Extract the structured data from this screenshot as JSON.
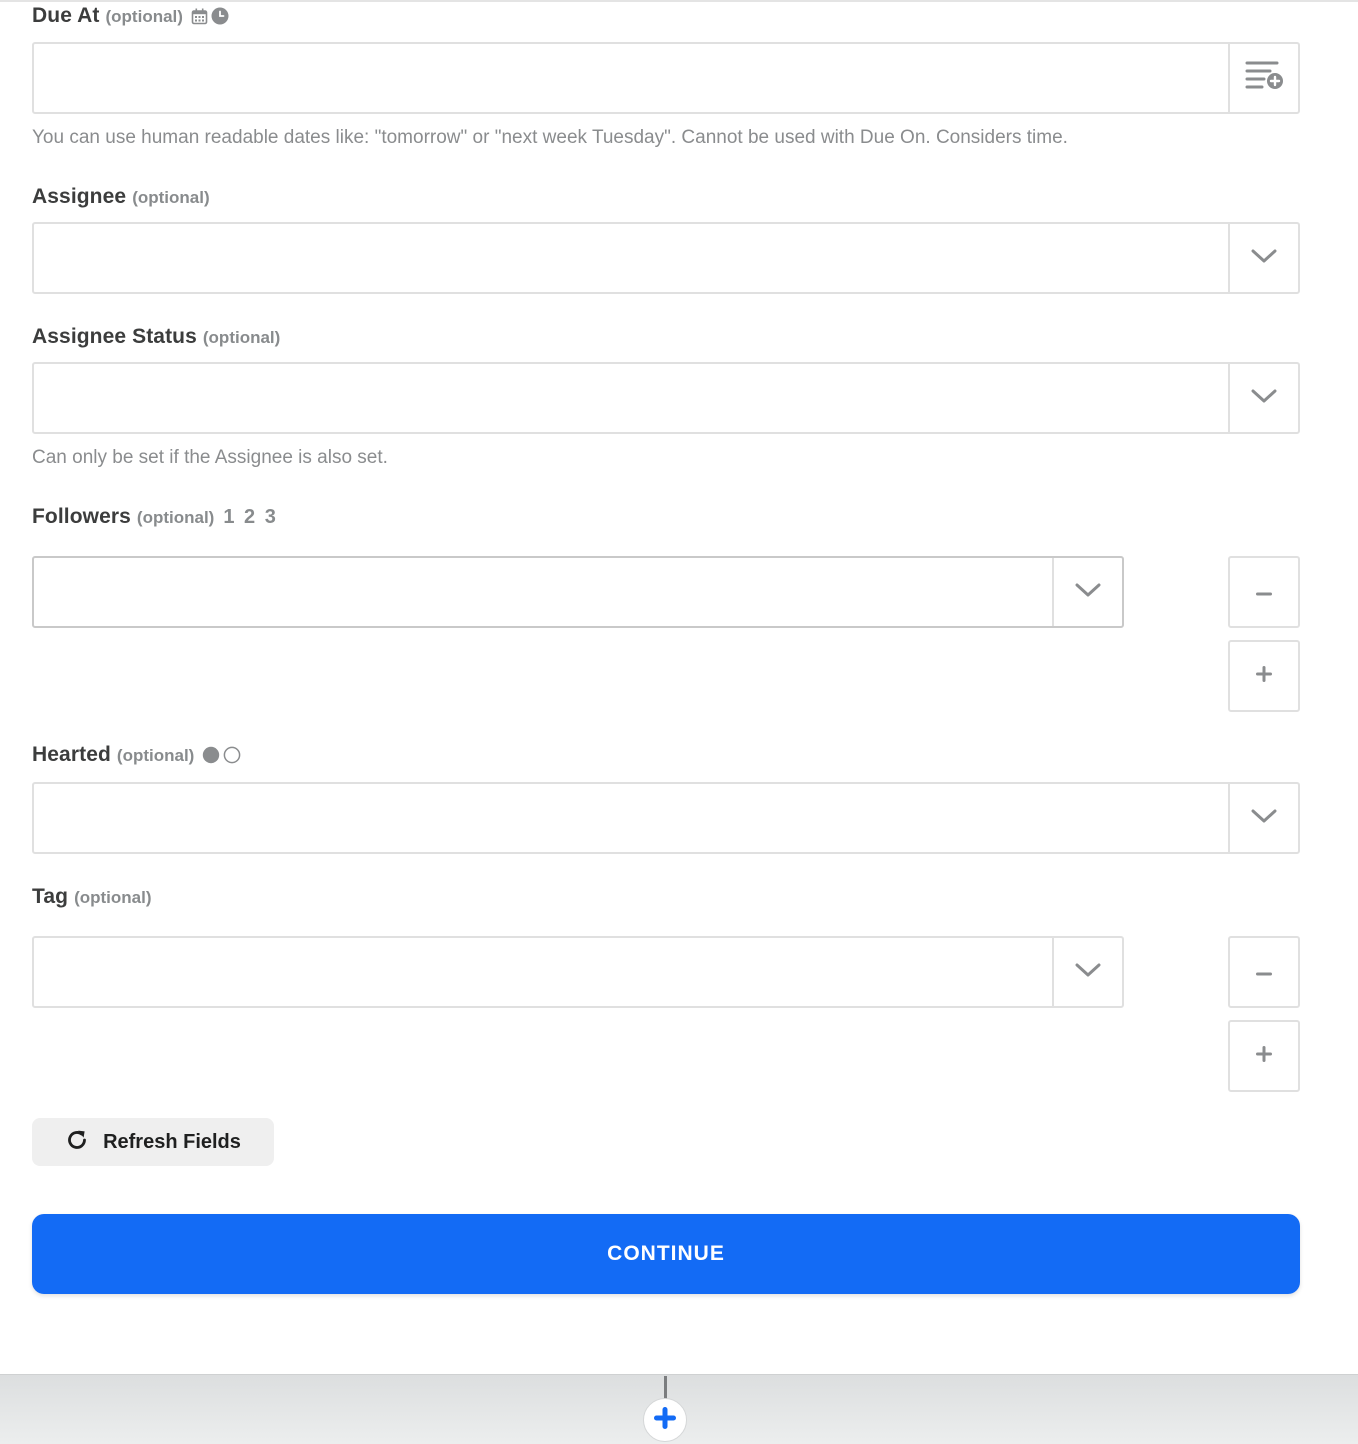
{
  "due_at": {
    "label": "Due At",
    "optional": "(optional)",
    "value": "",
    "help": "You can use human readable dates like: \"tomorrow\" or \"next week Tuesday\". Cannot be used with Due On. Considers time."
  },
  "assignee": {
    "label": "Assignee",
    "optional": "(optional)",
    "value": ""
  },
  "assignee_status": {
    "label": "Assignee Status",
    "optional": "(optional)",
    "value": "",
    "help": "Can only be set if the Assignee is also set."
  },
  "followers": {
    "label": "Followers",
    "optional": "(optional)",
    "list_indicator": "1 2 3",
    "value": ""
  },
  "hearted": {
    "label": "Hearted",
    "optional": "(optional)",
    "value": ""
  },
  "tag": {
    "label": "Tag",
    "optional": "(optional)",
    "value": ""
  },
  "buttons": {
    "refresh_fields": "Refresh Fields",
    "continue": "CONTINUE"
  },
  "colors": {
    "primary": "#136bf5",
    "muted_text": "#888b8d",
    "border": "#e0e0e0"
  }
}
